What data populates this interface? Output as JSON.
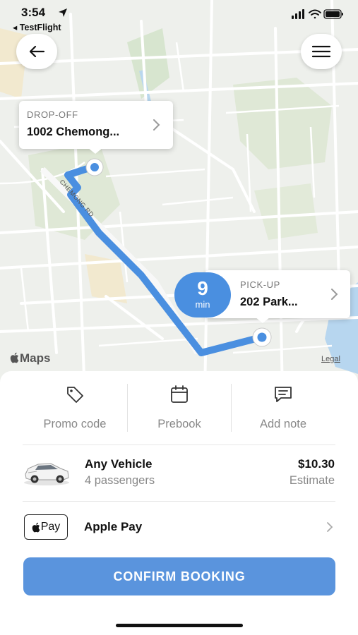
{
  "status_bar": {
    "time": "3:54",
    "back_app": "◂ TestFlight"
  },
  "map": {
    "dropoff": {
      "label": "DROP-OFF",
      "address": "1002 Chemong..."
    },
    "pickup": {
      "label": "PICK-UP",
      "address": "202 Park..."
    },
    "eta": {
      "value": "9",
      "unit": "min"
    },
    "street_label": "CHEMONG RD",
    "maps_logo": "Maps",
    "legal": "Legal",
    "route_color": "#4a8fe0"
  },
  "options": {
    "promo": "Promo code",
    "prebook": "Prebook",
    "note": "Add note"
  },
  "vehicle": {
    "name": "Any Vehicle",
    "passengers": "4 passengers",
    "price": "$10.30",
    "estimate": "Estimate"
  },
  "payment": {
    "badge": "Pay",
    "name": "Apple Pay"
  },
  "confirm_label": "CONFIRM BOOKING",
  "colors": {
    "accent": "#5a94dd",
    "map_bg": "#eef0ec"
  }
}
